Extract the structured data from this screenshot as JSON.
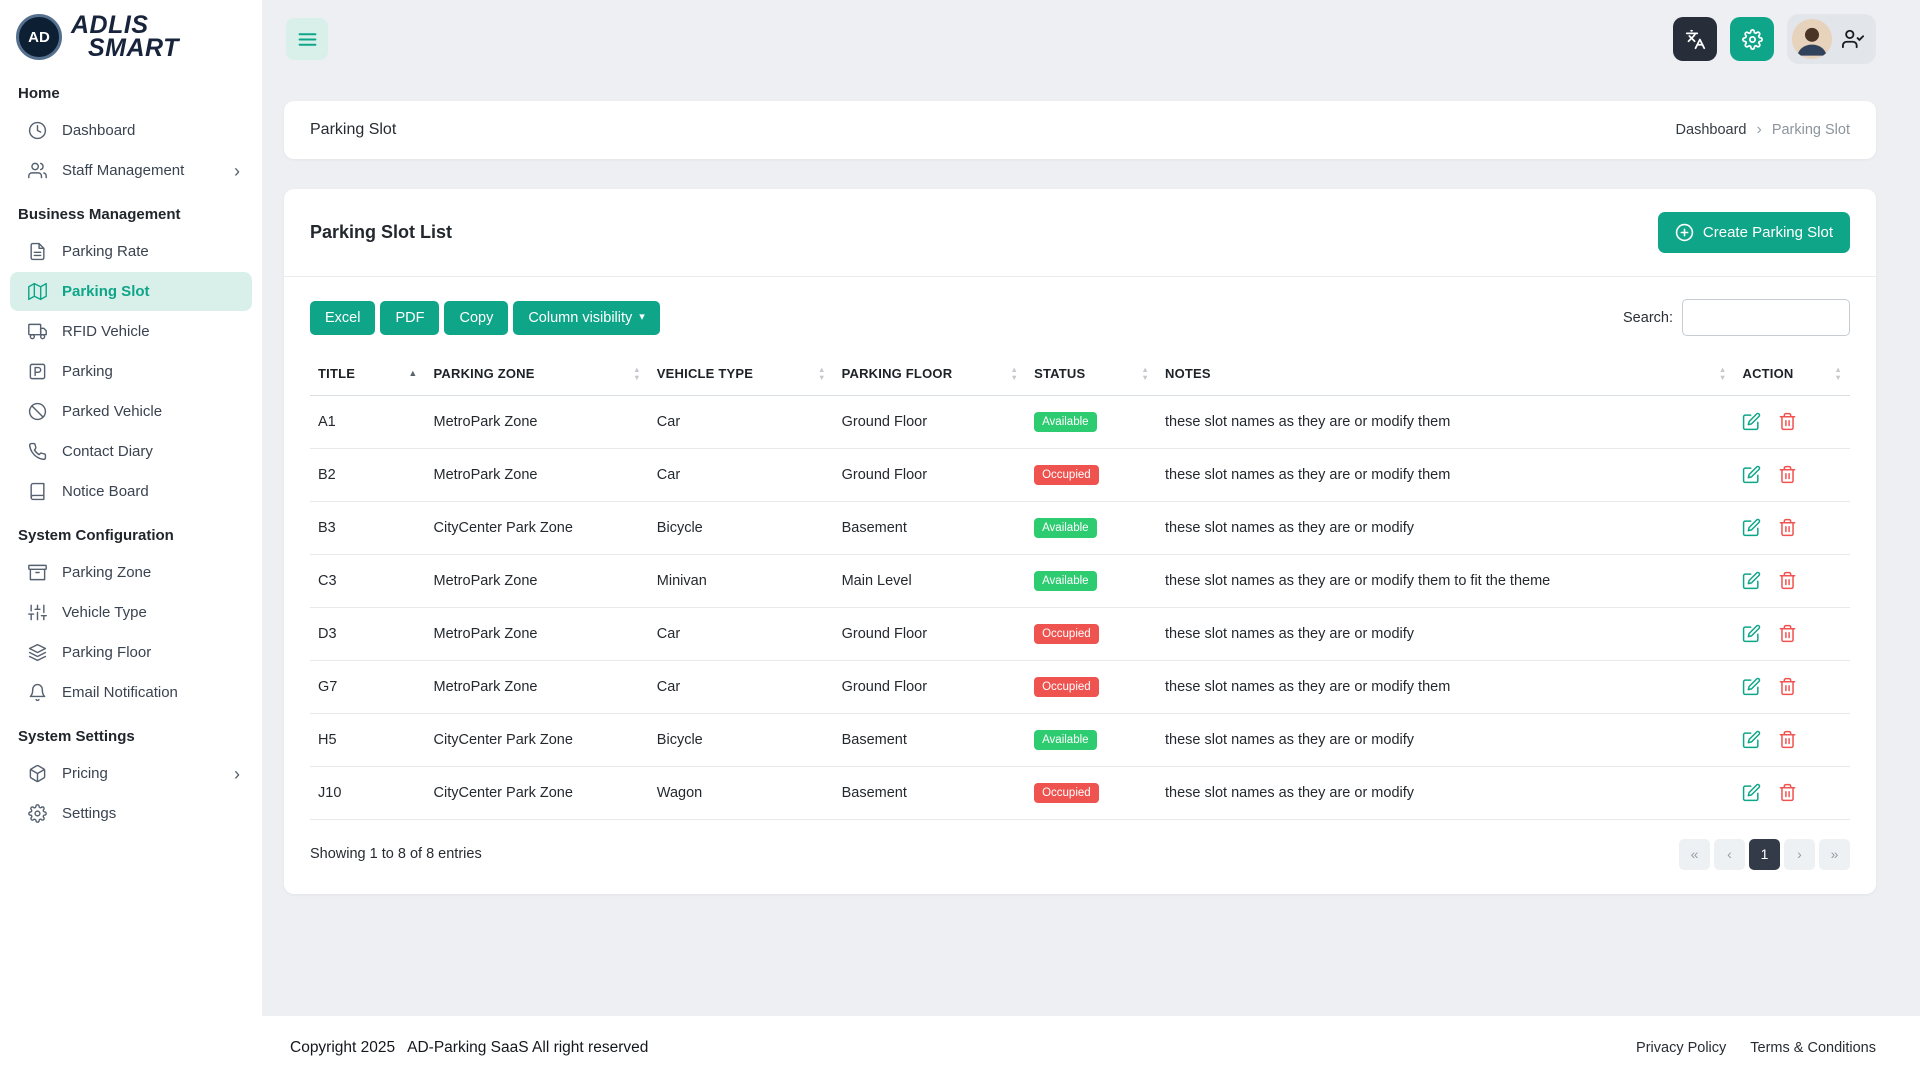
{
  "colors": {
    "primary": "#0fa589",
    "primary_light": "#d9f0ea",
    "available_badge": "#2ecc71",
    "occupied_badge": "#ef5350",
    "topbar_dark_button": "#272e3a",
    "pagination_active": "#333b48"
  },
  "brand": {
    "badge_text": "AD",
    "line1": "ADLIS",
    "line2": "SMART"
  },
  "header": {
    "menu_button_icon": "menu-icon",
    "language_button_icon": "languages-icon",
    "settings_button_icon": "gear-icon",
    "user_menu_icon": "user-check-icon"
  },
  "sidebar": {
    "sections": [
      {
        "title": "Home",
        "items": [
          {
            "label": "Dashboard",
            "icon": "dashboard-icon"
          },
          {
            "label": "Staff Management",
            "icon": "users-icon",
            "chevron": true
          }
        ]
      },
      {
        "title": "Business Management",
        "items": [
          {
            "label": "Parking Rate",
            "icon": "rate-file-icon"
          },
          {
            "label": "Parking Slot",
            "icon": "map-icon",
            "active": true
          },
          {
            "label": "RFID Vehicle",
            "icon": "vehicle-icon"
          },
          {
            "label": "Parking",
            "icon": "parking-icon"
          },
          {
            "label": "Parked Vehicle",
            "icon": "circle-slash-icon"
          },
          {
            "label": "Contact Diary",
            "icon": "phone-icon"
          },
          {
            "label": "Notice Board",
            "icon": "notice-icon"
          }
        ]
      },
      {
        "title": "System Configuration",
        "items": [
          {
            "label": "Parking Zone",
            "icon": "archive-icon"
          },
          {
            "label": "Vehicle Type",
            "icon": "sliders-icon"
          },
          {
            "label": "Parking Floor",
            "icon": "layers-icon"
          },
          {
            "label": "Email Notification",
            "icon": "bell-icon"
          }
        ]
      },
      {
        "title": "System Settings",
        "items": [
          {
            "label": "Pricing",
            "icon": "package-icon",
            "chevron": true
          },
          {
            "label": "Settings",
            "icon": "gear-icon"
          }
        ]
      }
    ]
  },
  "page": {
    "title": "Parking Slot",
    "breadcrumb": {
      "home": "Dashboard",
      "current": "Parking Slot"
    }
  },
  "table": {
    "title": "Parking Slot List",
    "create_button": "Create Parking Slot",
    "create_button_icon": "plus-circle-icon",
    "export_buttons": [
      "Excel",
      "PDF",
      "Copy"
    ],
    "column_visibility_button": "Column visibility",
    "search_label": "Search:",
    "search_value": "",
    "columns": [
      {
        "label": "TITLE",
        "sort": "asc"
      },
      {
        "label": "PARKING ZONE",
        "sort": "both"
      },
      {
        "label": "VEHICLE TYPE",
        "sort": "both"
      },
      {
        "label": "PARKING FLOOR",
        "sort": "both"
      },
      {
        "label": "STATUS",
        "sort": "both"
      },
      {
        "label": "NOTES",
        "sort": "both"
      },
      {
        "label": "ACTION",
        "sort": "both"
      }
    ],
    "action_icons": [
      "edit-icon",
      "trash-icon"
    ],
    "rows": [
      {
        "title": "A1",
        "zone": "MetroPark Zone",
        "vehicle_type": "Car",
        "floor": "Ground Floor",
        "status": "Available",
        "notes": "these slot names as they are or modify them"
      },
      {
        "title": "B2",
        "zone": "MetroPark Zone",
        "vehicle_type": "Car",
        "floor": "Ground Floor",
        "status": "Occupied",
        "notes": "these slot names as they are or modify them"
      },
      {
        "title": "B3",
        "zone": "CityCenter Park Zone",
        "vehicle_type": "Bicycle",
        "floor": "Basement",
        "status": "Available",
        "notes": "these slot names as they are or modify"
      },
      {
        "title": "C3",
        "zone": "MetroPark Zone",
        "vehicle_type": "Minivan",
        "floor": "Main Level",
        "status": "Available",
        "notes": "these slot names as they are or modify them to fit the theme"
      },
      {
        "title": "D3",
        "zone": "MetroPark Zone",
        "vehicle_type": "Car",
        "floor": "Ground Floor",
        "status": "Occupied",
        "notes": "these slot names as they are or modify"
      },
      {
        "title": "G7",
        "zone": "MetroPark Zone",
        "vehicle_type": "Car",
        "floor": "Ground Floor",
        "status": "Occupied",
        "notes": "these slot names as they are or modify them"
      },
      {
        "title": "H5",
        "zone": "CityCenter Park Zone",
        "vehicle_type": "Bicycle",
        "floor": "Basement",
        "status": "Available",
        "notes": "these slot names as they are or modify"
      },
      {
        "title": "J10",
        "zone": "CityCenter Park Zone",
        "vehicle_type": "Wagon",
        "floor": "Basement",
        "status": "Occupied",
        "notes": "these slot names as they are or modify"
      }
    ],
    "summary": "Showing 1 to 8 of 8 entries",
    "pagination": {
      "first": "«",
      "prev": "‹",
      "pages": [
        "1"
      ],
      "active": "1",
      "next": "›",
      "last": "»"
    }
  },
  "footer": {
    "copyright": "Copyright 2025",
    "brand_text": "AD-Parking SaaS All right reserved",
    "links": [
      "Privacy Policy",
      "Terms & Conditions"
    ]
  }
}
